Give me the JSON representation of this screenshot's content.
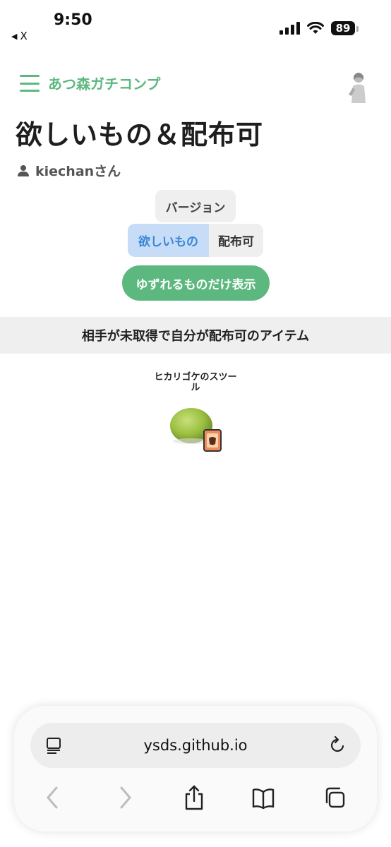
{
  "status_bar": {
    "time": "9:50",
    "back_app": "X",
    "battery": "89",
    "icons": [
      "back-arrow-icon",
      "cellular-signal-icon",
      "wifi-icon",
      "battery-icon"
    ]
  },
  "header": {
    "site_title": "あつ森ガチコンプ",
    "menu_icon": "hamburger-icon",
    "avatar_icon": "user-avatar"
  },
  "page": {
    "title": "欲しいもの＆配布可",
    "user_name": "kiechanさん",
    "user_icon": "person-icon"
  },
  "controls": {
    "version_label": "バージョン",
    "tabs": [
      {
        "label": "欲しいもの",
        "selected": true
      },
      {
        "label": "配布可",
        "selected": false
      }
    ],
    "filter_button": "ゆずれるものだけ表示"
  },
  "section": {
    "heading": "相手が未取得で自分が配布可のアイテム"
  },
  "items": [
    {
      "name": "ヒカリゴケのスツール",
      "icon": "moss-stool-icon",
      "badge_icon": "recipe-card-icon"
    }
  ],
  "browser": {
    "url": "ysds.github.io",
    "icons": [
      "reader-mode-icon",
      "reload-icon",
      "back-icon",
      "forward-icon",
      "share-icon",
      "bookmarks-icon",
      "tabs-icon"
    ]
  },
  "colors": {
    "accent_green": "#5cb87f",
    "selected_tab_bg": "#c7ddf7",
    "selected_tab_text": "#3a86d6",
    "section_bg": "#efefef"
  }
}
